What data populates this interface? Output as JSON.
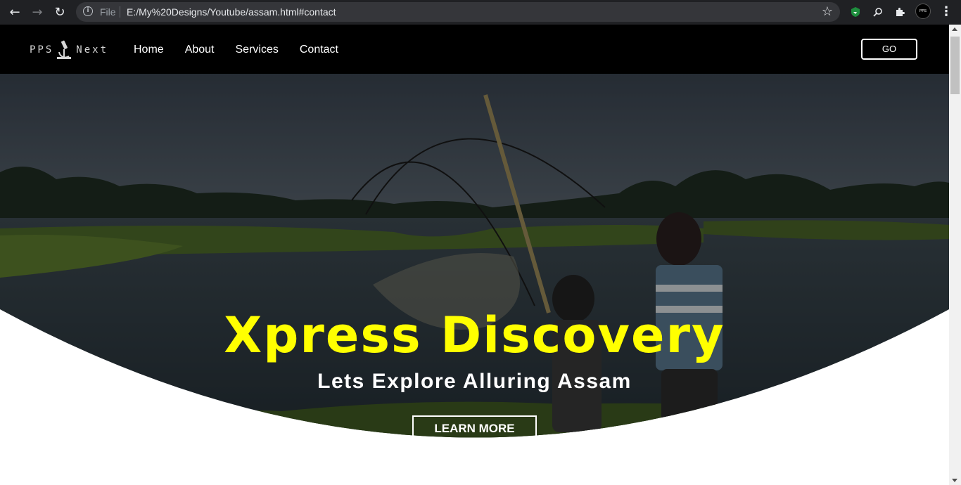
{
  "browser": {
    "file_label": "File",
    "url": "E:/My%20Designs/Youtube/assam.html#contact",
    "back_icon": "←",
    "forward_icon": "→",
    "reload_icon": "↻",
    "star_icon": "☆",
    "menu_icon": "⋮"
  },
  "nav": {
    "logo_left": "PPS",
    "logo_right": "Next",
    "items": [
      "Home",
      "About",
      "Services",
      "Contact"
    ],
    "go_label": "GO"
  },
  "hero": {
    "title": "Xpress Discovery",
    "subtitle": "Lets Explore Alluring Assam",
    "button_label": "LEARN MORE"
  },
  "colors": {
    "title": "#ffff00",
    "navbar": "#000000",
    "chrome": "#202124"
  }
}
